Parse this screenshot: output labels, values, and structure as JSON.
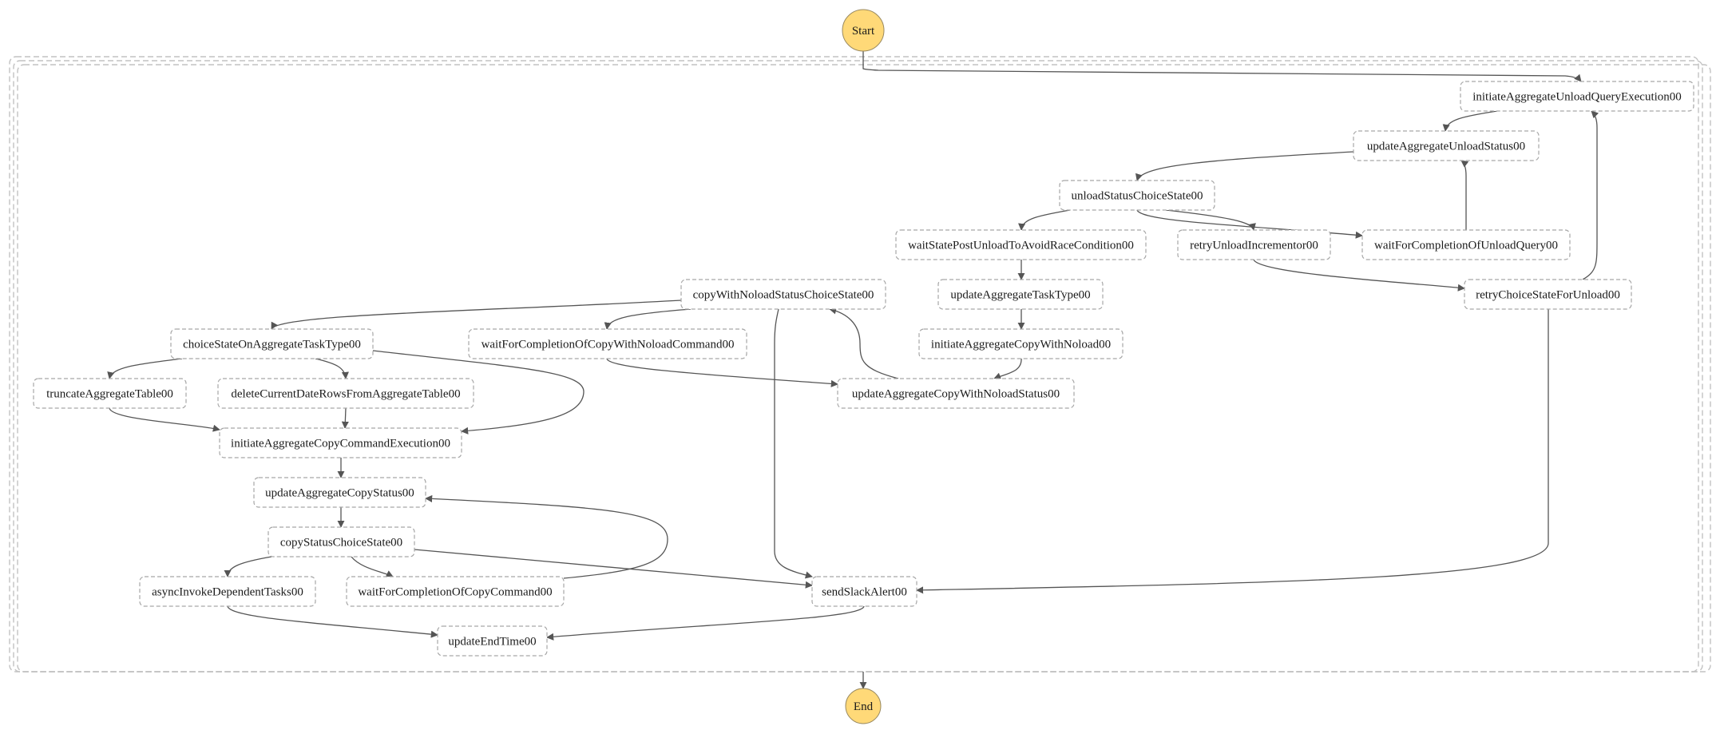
{
  "diagram": {
    "type": "state-machine-graph",
    "start": {
      "label": "Start",
      "color": "#ffd978"
    },
    "end": {
      "label": "End",
      "color": "#ffd978"
    },
    "states": [
      {
        "id": "initiateAggregateUnloadQueryExecution00",
        "label": "initiateAggregateUnloadQueryExecution00"
      },
      {
        "id": "updateAggregateUnloadStatus00",
        "label": "updateAggregateUnloadStatus00"
      },
      {
        "id": "unloadStatusChoiceState00",
        "label": "unloadStatusChoiceState00"
      },
      {
        "id": "waitStatePostUnloadToAvoidRaceCondition00",
        "label": "waitStatePostUnloadToAvoidRaceCondition00"
      },
      {
        "id": "retryUnloadIncrementor00",
        "label": "retryUnloadIncrementor00"
      },
      {
        "id": "waitForCompletionOfUnloadQuery00",
        "label": "waitForCompletionOfUnloadQuery00"
      },
      {
        "id": "copyWithNoloadStatusChoiceState00",
        "label": "copyWithNoloadStatusChoiceState00"
      },
      {
        "id": "updateAggregateTaskType00",
        "label": "updateAggregateTaskType00"
      },
      {
        "id": "retryChoiceStateForUnload00",
        "label": "retryChoiceStateForUnload00"
      },
      {
        "id": "choiceStateOnAggregateTaskType00",
        "label": "choiceStateOnAggregateTaskType00"
      },
      {
        "id": "waitForCompletionOfCopyWithNoloadCommand00",
        "label": "waitForCompletionOfCopyWithNoloadCommand00"
      },
      {
        "id": "initiateAggregateCopyWithNoload00",
        "label": "initiateAggregateCopyWithNoload00"
      },
      {
        "id": "truncateAggregateTable00",
        "label": "truncateAggregateTable00"
      },
      {
        "id": "deleteCurrentDateRowsFromAggregateTable00",
        "label": "deleteCurrentDateRowsFromAggregateTable00"
      },
      {
        "id": "updateAggregateCopyWithNoloadStatus00",
        "label": "updateAggregateCopyWithNoloadStatus00"
      },
      {
        "id": "initiateAggregateCopyCommandExecution00",
        "label": "initiateAggregateCopyCommandExecution00"
      },
      {
        "id": "updateAggregateCopyStatus00",
        "label": "updateAggregateCopyStatus00"
      },
      {
        "id": "copyStatusChoiceState00",
        "label": "copyStatusChoiceState00"
      },
      {
        "id": "asyncInvokeDependentTasks00",
        "label": "asyncInvokeDependentTasks00"
      },
      {
        "id": "waitForCompletionOfCopyCommand00",
        "label": "waitForCompletionOfCopyCommand00"
      },
      {
        "id": "sendSlackAlert00",
        "label": "sendSlackAlert00"
      },
      {
        "id": "updateEndTime00",
        "label": "updateEndTime00"
      }
    ],
    "transitions": [
      {
        "from": "Start",
        "to": "initiateAggregateUnloadQueryExecution00"
      },
      {
        "from": "initiateAggregateUnloadQueryExecution00",
        "to": "updateAggregateUnloadStatus00"
      },
      {
        "from": "updateAggregateUnloadStatus00",
        "to": "unloadStatusChoiceState00"
      },
      {
        "from": "unloadStatusChoiceState00",
        "to": "waitStatePostUnloadToAvoidRaceCondition00"
      },
      {
        "from": "unloadStatusChoiceState00",
        "to": "retryUnloadIncrementor00"
      },
      {
        "from": "unloadStatusChoiceState00",
        "to": "waitForCompletionOfUnloadQuery00"
      },
      {
        "from": "waitForCompletionOfUnloadQuery00",
        "to": "updateAggregateUnloadStatus00"
      },
      {
        "from": "retryUnloadIncrementor00",
        "to": "retryChoiceStateForUnload00"
      },
      {
        "from": "retryChoiceStateForUnload00",
        "to": "initiateAggregateUnloadQueryExecution00"
      },
      {
        "from": "retryChoiceStateForUnload00",
        "to": "sendSlackAlert00"
      },
      {
        "from": "waitStatePostUnloadToAvoidRaceCondition00",
        "to": "updateAggregateTaskType00"
      },
      {
        "from": "updateAggregateTaskType00",
        "to": "initiateAggregateCopyWithNoload00"
      },
      {
        "from": "initiateAggregateCopyWithNoload00",
        "to": "updateAggregateCopyWithNoloadStatus00"
      },
      {
        "from": "updateAggregateCopyWithNoloadStatus00",
        "to": "copyWithNoloadStatusChoiceState00"
      },
      {
        "from": "copyWithNoloadStatusChoiceState00",
        "to": "choiceStateOnAggregateTaskType00"
      },
      {
        "from": "copyWithNoloadStatusChoiceState00",
        "to": "waitForCompletionOfCopyWithNoloadCommand00"
      },
      {
        "from": "copyWithNoloadStatusChoiceState00",
        "to": "sendSlackAlert00"
      },
      {
        "from": "waitForCompletionOfCopyWithNoloadCommand00",
        "to": "updateAggregateCopyWithNoloadStatus00"
      },
      {
        "from": "choiceStateOnAggregateTaskType00",
        "to": "truncateAggregateTable00"
      },
      {
        "from": "choiceStateOnAggregateTaskType00",
        "to": "deleteCurrentDateRowsFromAggregateTable00"
      },
      {
        "from": "choiceStateOnAggregateTaskType00",
        "to": "initiateAggregateCopyCommandExecution00"
      },
      {
        "from": "truncateAggregateTable00",
        "to": "initiateAggregateCopyCommandExecution00"
      },
      {
        "from": "deleteCurrentDateRowsFromAggregateTable00",
        "to": "initiateAggregateCopyCommandExecution00"
      },
      {
        "from": "initiateAggregateCopyCommandExecution00",
        "to": "updateAggregateCopyStatus00"
      },
      {
        "from": "updateAggregateCopyStatus00",
        "to": "copyStatusChoiceState00"
      },
      {
        "from": "copyStatusChoiceState00",
        "to": "asyncInvokeDependentTasks00"
      },
      {
        "from": "copyStatusChoiceState00",
        "to": "waitForCompletionOfCopyCommand00"
      },
      {
        "from": "copyStatusChoiceState00",
        "to": "sendSlackAlert00"
      },
      {
        "from": "waitForCompletionOfCopyCommand00",
        "to": "updateAggregateCopyStatus00"
      },
      {
        "from": "asyncInvokeDependentTasks00",
        "to": "updateEndTime00"
      },
      {
        "from": "sendSlackAlert00",
        "to": "updateEndTime00"
      },
      {
        "from": "Container",
        "to": "End"
      }
    ]
  }
}
